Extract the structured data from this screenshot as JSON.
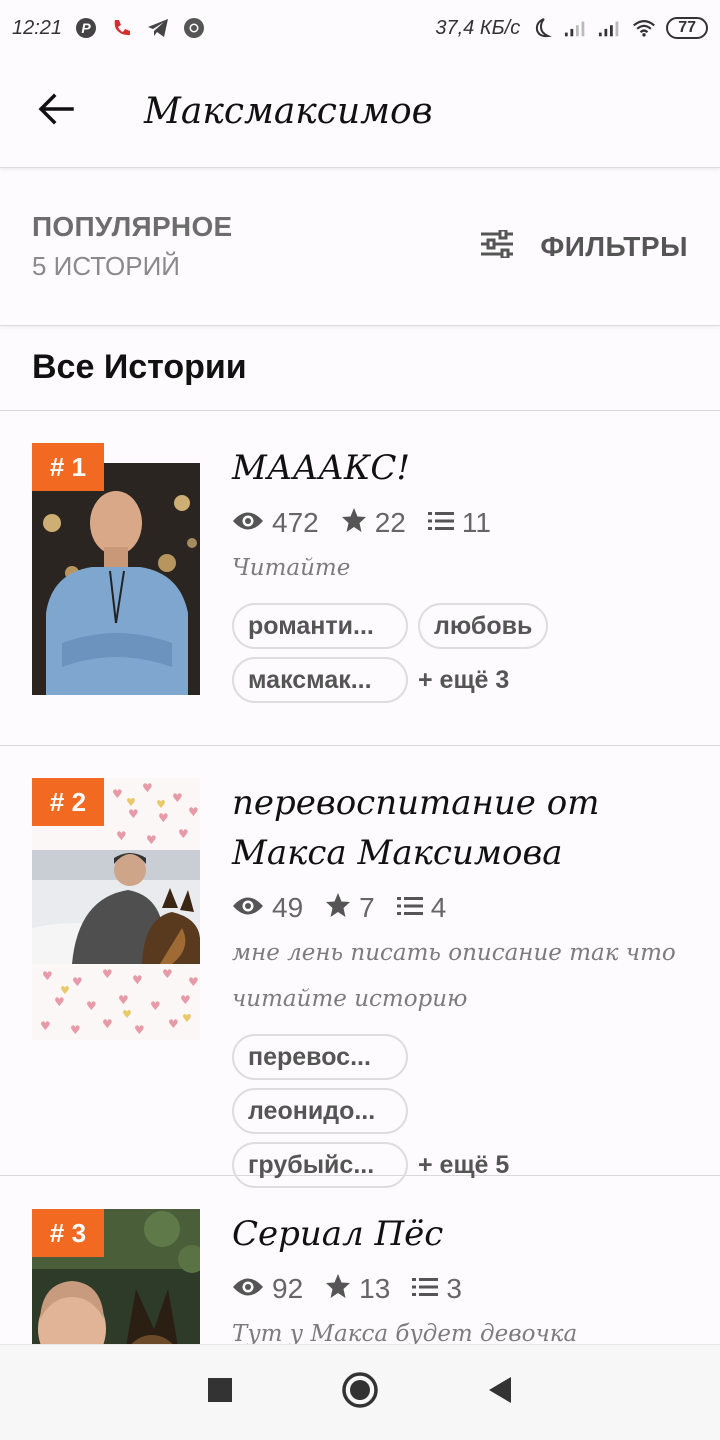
{
  "status_bar": {
    "time": "12:21",
    "network_speed": "37,4 КБ/с",
    "battery": "77",
    "icons": [
      "pinterest-icon",
      "missed-call-icon",
      "telegram-icon",
      "chrome-icon",
      "moon-icon",
      "signal-icon",
      "signal-icon",
      "wifi-icon"
    ]
  },
  "app_bar": {
    "title": "Максмаксимов",
    "back_icon": "arrow-left-icon"
  },
  "popular": {
    "title": "ПОПУЛЯРНОЕ",
    "count": "5 ИСТОРИЙ",
    "filters_label": "ФИЛЬТРЫ",
    "filters_icon": "sliders-icon"
  },
  "section": {
    "title": "Все Истории"
  },
  "accent": "#f26a22",
  "stories": [
    {
      "rank": "# 1",
      "title": "МАААКС!",
      "views": "472",
      "votes": "22",
      "parts": "11",
      "description": "Читайте",
      "tags": [
        "романти...",
        "любовь",
        "максмак..."
      ],
      "more": "+ ещё 3"
    },
    {
      "rank": "# 2",
      "title": "перевоспитание от Макса Максимова",
      "views": "49",
      "votes": "7",
      "parts": "4",
      "description": "мне лень писать описание так что читайте историю",
      "tags": [
        "перевос...",
        "леонидо...",
        "грубыйс..."
      ],
      "more": "+ ещё 5"
    },
    {
      "rank": "# 3",
      "title": "Сериал Пёс",
      "views": "92",
      "votes": "13",
      "parts": "3",
      "description": "Тут у Макса будет девочка"
    }
  ],
  "nav_bar": {
    "icons": [
      "recents-square-icon",
      "home-circle-icon",
      "back-triangle-icon"
    ]
  }
}
